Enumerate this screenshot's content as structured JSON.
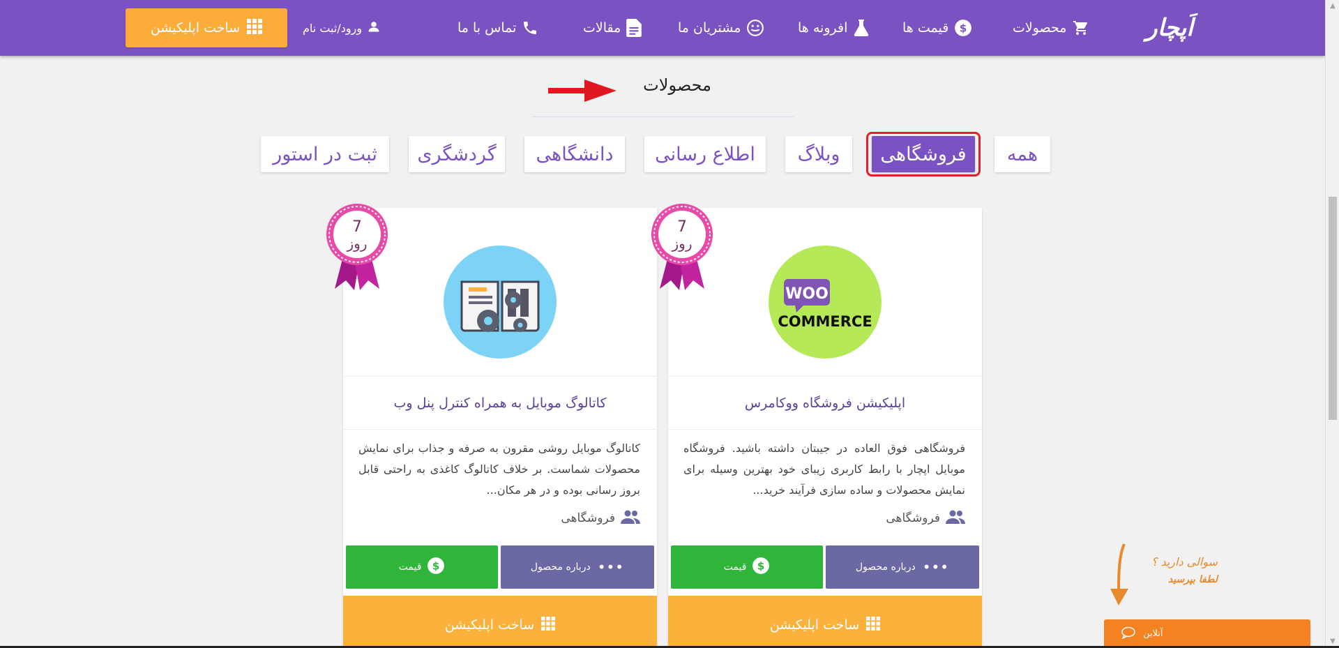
{
  "header": {
    "logo": "اَپچار",
    "nav": [
      {
        "label": "محصولات",
        "icon": "cart-icon"
      },
      {
        "label": "قیمت ها",
        "icon": "dollar-icon"
      },
      {
        "label": "افرونه ها",
        "icon": "flask-icon"
      },
      {
        "label": "مشتریان ما",
        "icon": "smiley-icon"
      },
      {
        "label": "مقالات",
        "icon": "document-icon"
      },
      {
        "label": "تماس با ما",
        "icon": "phone-icon"
      }
    ],
    "login": "ورود/ثبت نام",
    "make_app": "ساخت اپلیکیشن",
    "colors": {
      "bar": "#7b52c2",
      "button": "#fbac3a"
    }
  },
  "section": {
    "title": "محصولات"
  },
  "tabs": [
    {
      "label": "همه",
      "active": false
    },
    {
      "label": "فروشگاهی",
      "active": true
    },
    {
      "label": "وبلاگ",
      "active": false
    },
    {
      "label": "اطلاع رسانی",
      "active": false
    },
    {
      "label": "دانشگاهی",
      "active": false
    },
    {
      "label": "گردشگری",
      "active": false
    },
    {
      "label": "ثبت در استور",
      "active": false
    }
  ],
  "cards": [
    {
      "ribbon_num": "7",
      "ribbon_unit": "روز",
      "logo_top": "WOO",
      "logo_bottom": "COMMERCE",
      "title": "اپلیکیشن فروشگاه ووکامرس",
      "description": "فروشگاهی فوق العاده در جیبتان داشته باشید. فروشگاه موبایل اپچار با رابط کاربری زیبای خود بهترین وسیله برای نمایش محصولات و ساده سازی فرآیند خرید...",
      "category": "فروشگاهی",
      "about": "درباره محصول",
      "price": "قیمت",
      "make_app": "ساخت اپلیکیشن"
    },
    {
      "ribbon_num": "7",
      "ribbon_unit": "روز",
      "title": "کاتالوگ موبایل به همراه کنترل پنل وب",
      "description": "کاتالوگ موبایل روشی مقرون به صرفه و جذاب برای نمایش محصولات شماست. بر خلاف کاتالوگ کاغذی به راحتی قابل بروز رسانی بوده و در هر مکان...",
      "category": "فروشگاهی",
      "about": "درباره محصول",
      "price": "قیمت",
      "make_app": "ساخت اپلیکیشن"
    }
  ],
  "help": {
    "line1": "سوالی دارید ؟",
    "line2": "لطفا بپرسید"
  },
  "chat": {
    "label": "آنلاین"
  }
}
